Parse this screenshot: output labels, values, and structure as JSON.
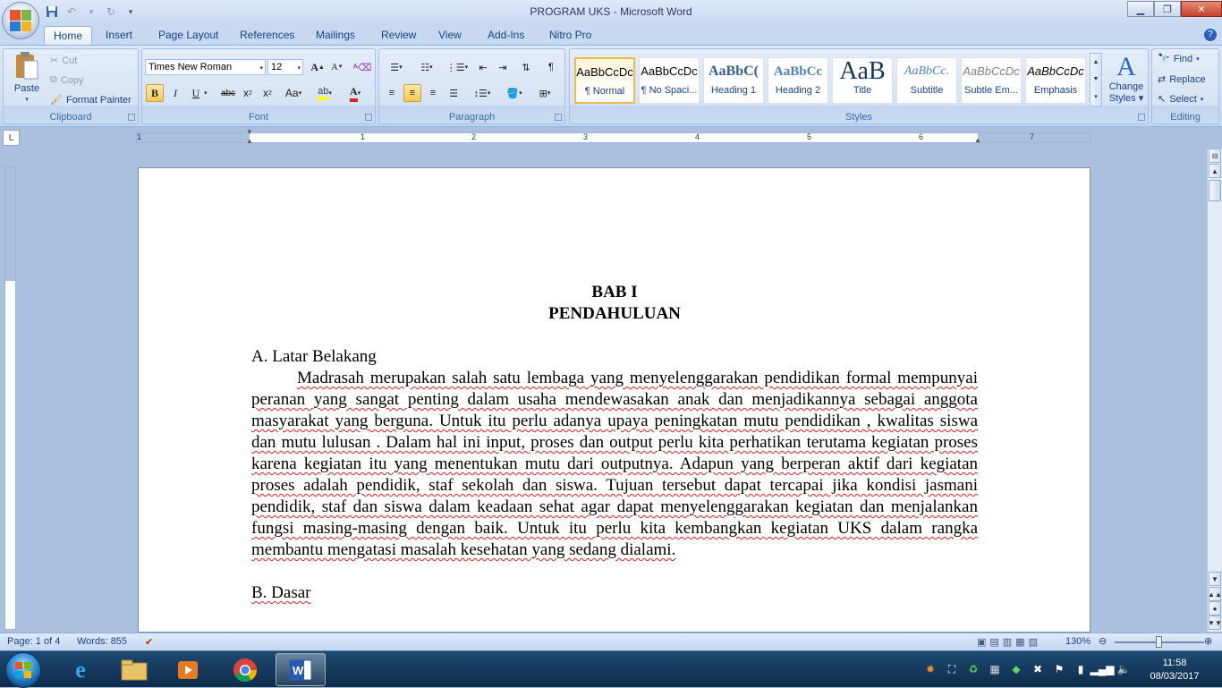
{
  "window": {
    "title": "PROGRAM UKS - Microsoft Word"
  },
  "ribbon_tabs": [
    "Home",
    "Insert",
    "Page Layout",
    "References",
    "Mailings",
    "Review",
    "View",
    "Add-Ins",
    "Nitro Pro"
  ],
  "clipboard": {
    "paste": "Paste",
    "cut": "Cut",
    "copy": "Copy",
    "format_painter": "Format Painter",
    "label": "Clipboard"
  },
  "font": {
    "name": "Times New Roman",
    "size": "12",
    "label": "Font",
    "grow": "A",
    "shrink": "A",
    "bold": "B",
    "italic": "I",
    "underline": "U",
    "strike": "abc",
    "sub": "x",
    "sup": "x",
    "case": "Aa"
  },
  "paragraph": {
    "label": "Paragraph"
  },
  "styles": {
    "label": "Styles",
    "items": [
      {
        "preview": "AaBbCcDc",
        "name": "¶ Normal"
      },
      {
        "preview": "AaBbCcDc",
        "name": "¶ No Spaci..."
      },
      {
        "preview": "AaBbC(",
        "name": "Heading 1"
      },
      {
        "preview": "AaBbCc",
        "name": "Heading 2"
      },
      {
        "preview": "AaB",
        "name": "Title"
      },
      {
        "preview": "AaBbCc.",
        "name": "Subtitle"
      },
      {
        "preview": "AaBbCcDc",
        "name": "Subtle Em..."
      },
      {
        "preview": "AaBbCcDc",
        "name": "Emphasis"
      }
    ],
    "change": "Change",
    "change2": "Styles"
  },
  "editing": {
    "label": "Editing",
    "find": "Find",
    "replace": "Replace",
    "select": "Select"
  },
  "ruler": {
    "numbers": [
      "1",
      "1",
      "2",
      "3",
      "4",
      "5",
      "6",
      "7"
    ]
  },
  "document": {
    "heading1": "BAB I",
    "heading2": "PENDAHULUAN",
    "sectionA": "A. Latar Belakang",
    "paragraph": "Madrasah merupakan salah satu lembaga yang menyelenggarakan pendidikan formal mempunyai peranan yang sangat penting dalam usaha mendewasakan anak dan menjadikannya sebagai anggota masyarakat yang berguna. Untuk itu perlu adanya upaya  peningkatan mutu pendidikan , kwalitas siswa dan mutu lulusan . Dalam hal ini input, proses dan output perlu kita perhatikan terutama kegiatan proses karena kegiatan itu yang menentukan mutu dari outputnya. Adapun yang berperan aktif dari kegiatan proses adalah pendidik, staf sekolah dan siswa. Tujuan tersebut dapat tercapai jika kondisi jasmani pendidik, staf dan siswa dalam keadaan sehat agar dapat menyelenggarakan kegiatan dan menjalankan fungsi masing-masing dengan baik. Untuk itu perlu kita kembangkan kegiatan UKS dalam rangka membantu mengatasi masalah kesehatan yang sedang dialami.",
    "sectionB": "B. Dasar"
  },
  "status": {
    "page": "Page: 1 of 4",
    "words": "Words: 855",
    "zoom": "130%"
  },
  "clock": {
    "time": "11:58",
    "date": "08/03/2017"
  }
}
